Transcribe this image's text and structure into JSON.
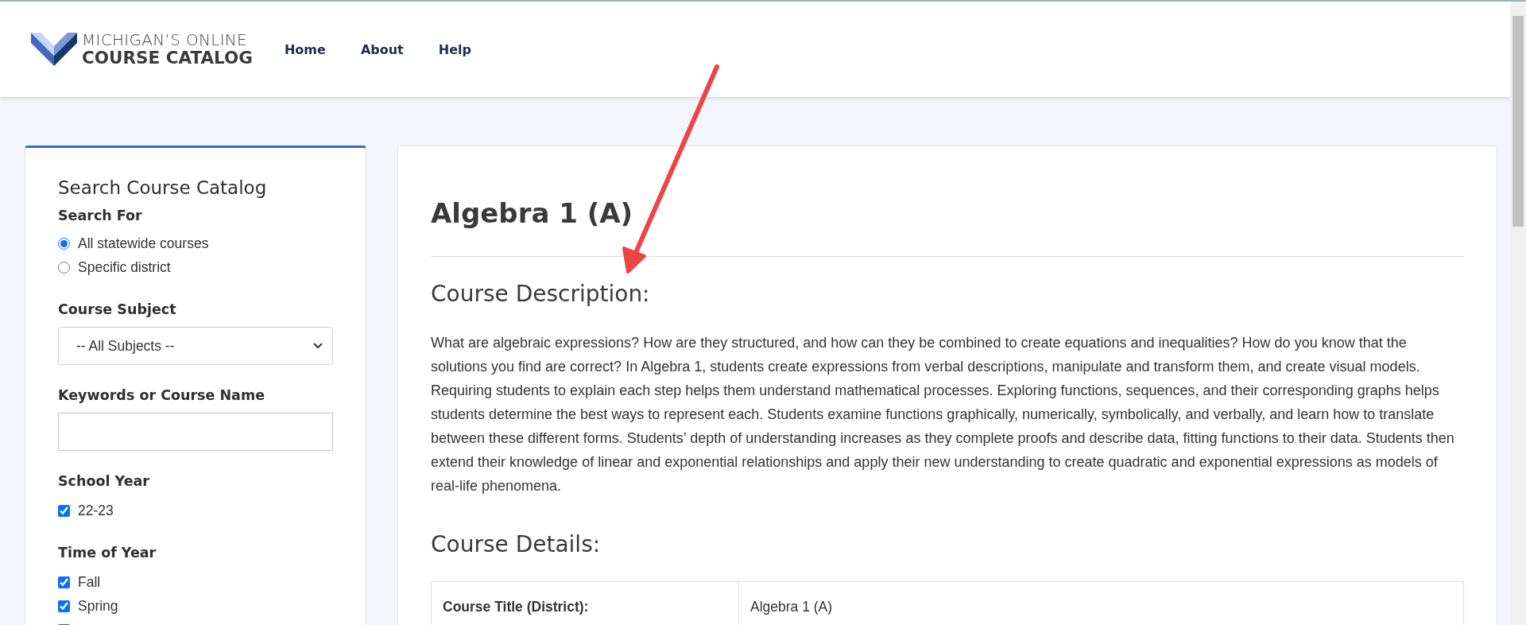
{
  "header": {
    "logo": {
      "line_1": "MICHIGAN’S ONLINE",
      "line_2": "COURSE CATALOG"
    },
    "nav": [
      {
        "label": "Home"
      },
      {
        "label": "About"
      },
      {
        "label": "Help"
      }
    ]
  },
  "sidebar": {
    "title": "Search Course Catalog",
    "search_for": {
      "label": "Search For",
      "options": [
        {
          "label": "All statewide courses",
          "selected": true
        },
        {
          "label": "Specific district",
          "selected": false
        }
      ]
    },
    "course_subject": {
      "label": "Course Subject",
      "value": "-- All Subjects --"
    },
    "keywords": {
      "label": "Keywords or Course Name"
    },
    "school_year": {
      "label": "School Year",
      "options": [
        {
          "label": "22-23",
          "checked": true
        }
      ]
    },
    "time_of_year": {
      "label": "Time of Year",
      "options": [
        {
          "label": "Fall",
          "checked": true
        },
        {
          "label": "Spring",
          "checked": true
        },
        {
          "checked": true
        }
      ]
    }
  },
  "course": {
    "title": "Algebra 1 (A)",
    "description_heading": "Course Description:",
    "description": "What are algebraic expressions? How are they structured, and how can they be combined to create equations and inequalities? How do you know that the solutions you find are correct? In Algebra 1, students create expressions from verbal descriptions, manipulate and transform them, and create visual models. Requiring students to explain each step helps them understand mathematical processes. Exploring functions, sequences, and their corresponding graphs helps students determine the best ways to represent each. Students examine functions graphically, numerically, symbolically, and verbally, and learn how to translate between these different forms. Students’ depth of understanding increases as they complete proofs and describe data, fitting functions to their data. Students then extend their knowledge of linear and exponential relationships and apply their new understanding to create quadratic and exponential expressions as models of real-life phenomena.",
    "details_heading": "Course Details:",
    "details": [
      {
        "label": "Course Title (District):",
        "value": "Algebra 1 (A)"
      }
    ]
  }
}
